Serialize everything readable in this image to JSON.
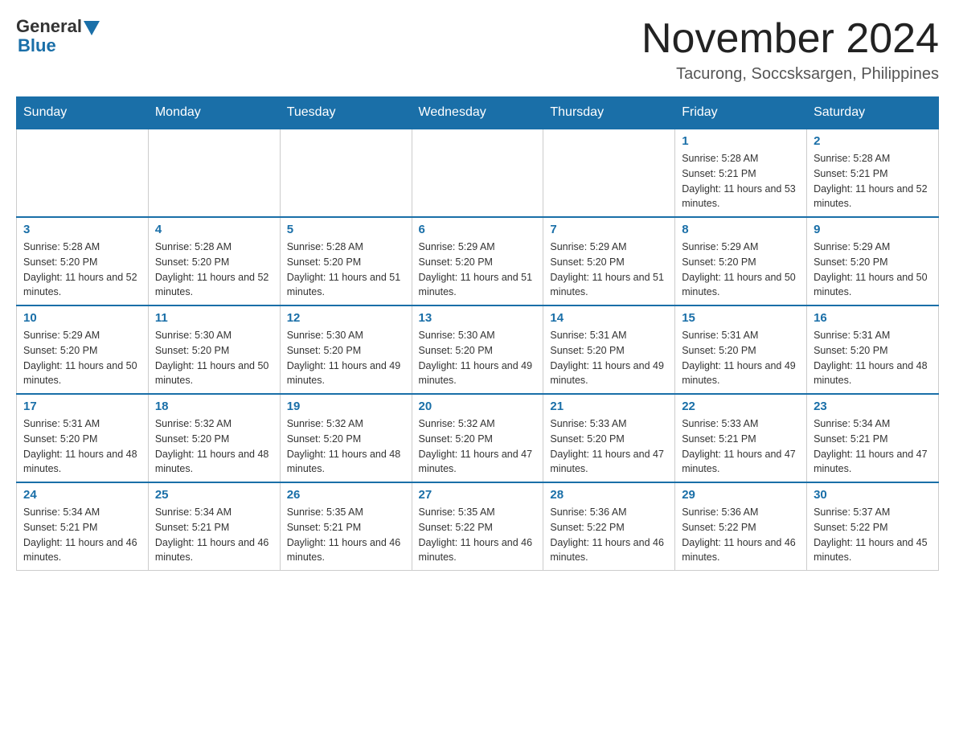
{
  "logo": {
    "general": "General",
    "blue": "Blue"
  },
  "title": "November 2024",
  "location": "Tacurong, Soccsksargen, Philippines",
  "weekdays": [
    "Sunday",
    "Monday",
    "Tuesday",
    "Wednesday",
    "Thursday",
    "Friday",
    "Saturday"
  ],
  "weeks": [
    [
      {
        "day": "",
        "sunrise": "",
        "sunset": "",
        "daylight": ""
      },
      {
        "day": "",
        "sunrise": "",
        "sunset": "",
        "daylight": ""
      },
      {
        "day": "",
        "sunrise": "",
        "sunset": "",
        "daylight": ""
      },
      {
        "day": "",
        "sunrise": "",
        "sunset": "",
        "daylight": ""
      },
      {
        "day": "",
        "sunrise": "",
        "sunset": "",
        "daylight": ""
      },
      {
        "day": "1",
        "sunrise": "Sunrise: 5:28 AM",
        "sunset": "Sunset: 5:21 PM",
        "daylight": "Daylight: 11 hours and 53 minutes."
      },
      {
        "day": "2",
        "sunrise": "Sunrise: 5:28 AM",
        "sunset": "Sunset: 5:21 PM",
        "daylight": "Daylight: 11 hours and 52 minutes."
      }
    ],
    [
      {
        "day": "3",
        "sunrise": "Sunrise: 5:28 AM",
        "sunset": "Sunset: 5:20 PM",
        "daylight": "Daylight: 11 hours and 52 minutes."
      },
      {
        "day": "4",
        "sunrise": "Sunrise: 5:28 AM",
        "sunset": "Sunset: 5:20 PM",
        "daylight": "Daylight: 11 hours and 52 minutes."
      },
      {
        "day": "5",
        "sunrise": "Sunrise: 5:28 AM",
        "sunset": "Sunset: 5:20 PM",
        "daylight": "Daylight: 11 hours and 51 minutes."
      },
      {
        "day": "6",
        "sunrise": "Sunrise: 5:29 AM",
        "sunset": "Sunset: 5:20 PM",
        "daylight": "Daylight: 11 hours and 51 minutes."
      },
      {
        "day": "7",
        "sunrise": "Sunrise: 5:29 AM",
        "sunset": "Sunset: 5:20 PM",
        "daylight": "Daylight: 11 hours and 51 minutes."
      },
      {
        "day": "8",
        "sunrise": "Sunrise: 5:29 AM",
        "sunset": "Sunset: 5:20 PM",
        "daylight": "Daylight: 11 hours and 50 minutes."
      },
      {
        "day": "9",
        "sunrise": "Sunrise: 5:29 AM",
        "sunset": "Sunset: 5:20 PM",
        "daylight": "Daylight: 11 hours and 50 minutes."
      }
    ],
    [
      {
        "day": "10",
        "sunrise": "Sunrise: 5:29 AM",
        "sunset": "Sunset: 5:20 PM",
        "daylight": "Daylight: 11 hours and 50 minutes."
      },
      {
        "day": "11",
        "sunrise": "Sunrise: 5:30 AM",
        "sunset": "Sunset: 5:20 PM",
        "daylight": "Daylight: 11 hours and 50 minutes."
      },
      {
        "day": "12",
        "sunrise": "Sunrise: 5:30 AM",
        "sunset": "Sunset: 5:20 PM",
        "daylight": "Daylight: 11 hours and 49 minutes."
      },
      {
        "day": "13",
        "sunrise": "Sunrise: 5:30 AM",
        "sunset": "Sunset: 5:20 PM",
        "daylight": "Daylight: 11 hours and 49 minutes."
      },
      {
        "day": "14",
        "sunrise": "Sunrise: 5:31 AM",
        "sunset": "Sunset: 5:20 PM",
        "daylight": "Daylight: 11 hours and 49 minutes."
      },
      {
        "day": "15",
        "sunrise": "Sunrise: 5:31 AM",
        "sunset": "Sunset: 5:20 PM",
        "daylight": "Daylight: 11 hours and 49 minutes."
      },
      {
        "day": "16",
        "sunrise": "Sunrise: 5:31 AM",
        "sunset": "Sunset: 5:20 PM",
        "daylight": "Daylight: 11 hours and 48 minutes."
      }
    ],
    [
      {
        "day": "17",
        "sunrise": "Sunrise: 5:31 AM",
        "sunset": "Sunset: 5:20 PM",
        "daylight": "Daylight: 11 hours and 48 minutes."
      },
      {
        "day": "18",
        "sunrise": "Sunrise: 5:32 AM",
        "sunset": "Sunset: 5:20 PM",
        "daylight": "Daylight: 11 hours and 48 minutes."
      },
      {
        "day": "19",
        "sunrise": "Sunrise: 5:32 AM",
        "sunset": "Sunset: 5:20 PM",
        "daylight": "Daylight: 11 hours and 48 minutes."
      },
      {
        "day": "20",
        "sunrise": "Sunrise: 5:32 AM",
        "sunset": "Sunset: 5:20 PM",
        "daylight": "Daylight: 11 hours and 47 minutes."
      },
      {
        "day": "21",
        "sunrise": "Sunrise: 5:33 AM",
        "sunset": "Sunset: 5:20 PM",
        "daylight": "Daylight: 11 hours and 47 minutes."
      },
      {
        "day": "22",
        "sunrise": "Sunrise: 5:33 AM",
        "sunset": "Sunset: 5:21 PM",
        "daylight": "Daylight: 11 hours and 47 minutes."
      },
      {
        "day": "23",
        "sunrise": "Sunrise: 5:34 AM",
        "sunset": "Sunset: 5:21 PM",
        "daylight": "Daylight: 11 hours and 47 minutes."
      }
    ],
    [
      {
        "day": "24",
        "sunrise": "Sunrise: 5:34 AM",
        "sunset": "Sunset: 5:21 PM",
        "daylight": "Daylight: 11 hours and 46 minutes."
      },
      {
        "day": "25",
        "sunrise": "Sunrise: 5:34 AM",
        "sunset": "Sunset: 5:21 PM",
        "daylight": "Daylight: 11 hours and 46 minutes."
      },
      {
        "day": "26",
        "sunrise": "Sunrise: 5:35 AM",
        "sunset": "Sunset: 5:21 PM",
        "daylight": "Daylight: 11 hours and 46 minutes."
      },
      {
        "day": "27",
        "sunrise": "Sunrise: 5:35 AM",
        "sunset": "Sunset: 5:22 PM",
        "daylight": "Daylight: 11 hours and 46 minutes."
      },
      {
        "day": "28",
        "sunrise": "Sunrise: 5:36 AM",
        "sunset": "Sunset: 5:22 PM",
        "daylight": "Daylight: 11 hours and 46 minutes."
      },
      {
        "day": "29",
        "sunrise": "Sunrise: 5:36 AM",
        "sunset": "Sunset: 5:22 PM",
        "daylight": "Daylight: 11 hours and 46 minutes."
      },
      {
        "day": "30",
        "sunrise": "Sunrise: 5:37 AM",
        "sunset": "Sunset: 5:22 PM",
        "daylight": "Daylight: 11 hours and 45 minutes."
      }
    ]
  ]
}
